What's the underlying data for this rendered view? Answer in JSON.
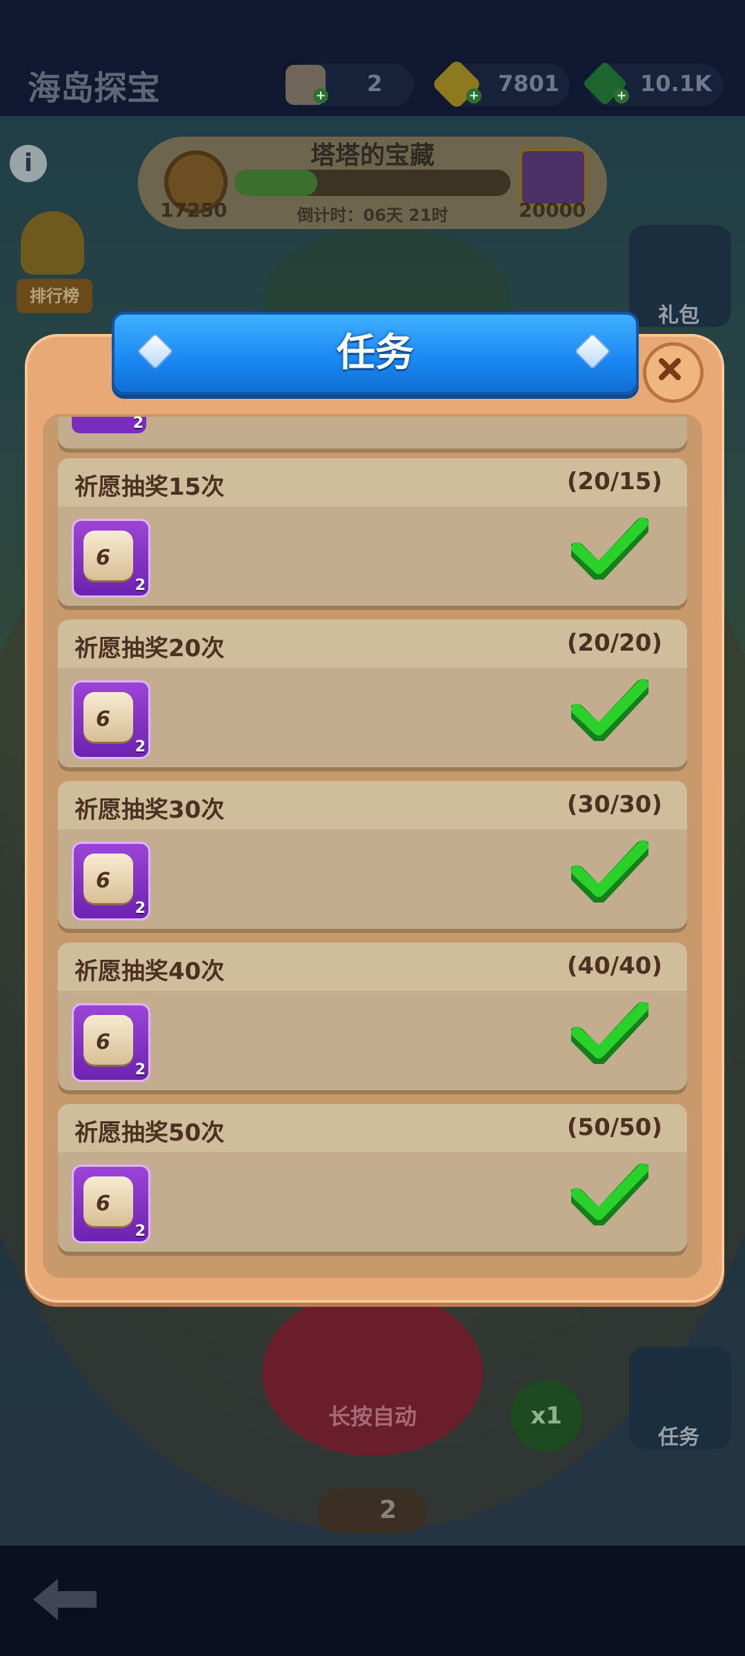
{
  "header": {
    "title": "海岛探宝",
    "resources": [
      {
        "name": "dice",
        "value": "2"
      },
      {
        "name": "gold",
        "value": "7801"
      },
      {
        "name": "gems",
        "value": "10.1K"
      }
    ]
  },
  "event": {
    "title": "塔塔的宝藏",
    "current_score": "17250",
    "target_score": "20000",
    "countdown": "倒计时：06天 21时",
    "progress_fraction": 0.3
  },
  "side": {
    "ranking_label": "排行榜",
    "gift_label": "礼包",
    "task_label": "任务"
  },
  "roll": {
    "button_label": "长按自动",
    "multiplier": "x1",
    "dice_count": "2"
  },
  "modal": {
    "title": "任务",
    "partial_qty": "2",
    "tasks": [
      {
        "name": "祈愿抽奖15次",
        "progress": "(20/15)",
        "reward_qty": "2",
        "reward_icon": "dice-icon",
        "completed": true
      },
      {
        "name": "祈愿抽奖20次",
        "progress": "(20/20)",
        "reward_qty": "2",
        "reward_icon": "dice-icon",
        "completed": true
      },
      {
        "name": "祈愿抽奖30次",
        "progress": "(30/30)",
        "reward_qty": "2",
        "reward_icon": "dice-icon",
        "completed": true
      },
      {
        "name": "祈愿抽奖40次",
        "progress": "(40/40)",
        "reward_qty": "2",
        "reward_icon": "dice-icon",
        "completed": true
      },
      {
        "name": "祈愿抽奖50次",
        "progress": "(50/50)",
        "reward_qty": "2",
        "reward_icon": "dice-icon",
        "completed": true
      }
    ]
  },
  "colors": {
    "ribbon_blue": "#1a87f2",
    "modal_frame": "#e9a976",
    "card_body": "#c2ad8f",
    "check_green": "#2bd12b",
    "reward_purple": "#7b2cc0"
  }
}
